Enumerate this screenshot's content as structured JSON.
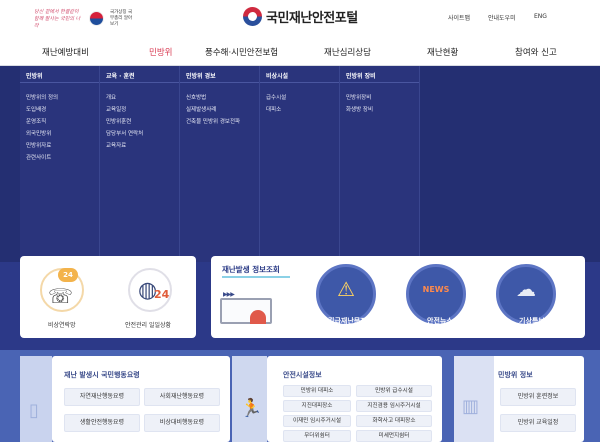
{
  "header": {
    "slogan_line1": "당신 곁에서 한결같이",
    "slogan_line2": "함께 잘사는 국민의 나라",
    "gov_mark": "국가상징 국무총리 알아보기",
    "logo": "국민재난안전포털",
    "util": {
      "sitemap": "사이트맵",
      "guide": "안내도우미",
      "eng": "ENG"
    }
  },
  "gnb": [
    {
      "label": "재난예방대비",
      "active": false
    },
    {
      "label": "민방위",
      "active": true
    },
    {
      "label": "풍수해·시민안전보험",
      "active": false
    },
    {
      "label": "재난심리상담",
      "active": false
    },
    {
      "label": "재난현황",
      "active": false
    },
    {
      "label": "참여와 신고",
      "active": false
    }
  ],
  "mega": [
    {
      "head": "민방위",
      "items": [
        "민방위의 정의",
        "도입배경",
        "운영조직",
        "외국민방위",
        "민방위자료",
        "관련사이트"
      ]
    },
    {
      "head": "교육 · 훈련",
      "items": [
        "개요",
        "교육일정",
        "민방위훈련",
        "담당부서 연락처",
        "교육자료"
      ]
    },
    {
      "head": "민방위 경보",
      "items": [
        "신호방법",
        "실제발생사례",
        "건축물 민방위 경보전파"
      ]
    },
    {
      "head": "비상시설",
      "items": [
        "급수시설",
        "대피소"
      ]
    },
    {
      "head": "민방위 장비",
      "items": [
        "민방위장비",
        "화생방 장비"
      ]
    }
  ],
  "services": {
    "emergency_label": "비상연락망",
    "safety_label": "안전관리 일일상황",
    "badge": "24"
  },
  "disaster_info": {
    "title": "재난발생 정보조회",
    "alert": "긴급재난문자",
    "news": "안전뉴스",
    "news_badge": "NEWS",
    "weather": "기상특보"
  },
  "panels": {
    "action": {
      "title": "재난 발생시 국민행동요령",
      "buttons": [
        "자연재난행동요령",
        "사회재난행동요령",
        "생활안전행동요령",
        "비상대비행동요령"
      ]
    },
    "facility": {
      "title": "안전시설정보",
      "buttons": [
        "민방위 대피소",
        "민방위 급수시설",
        "지진대피장소",
        "지진겸용 임시주거시설",
        "이재민 임시주거시설",
        "화학사고 대피장소",
        "무더위쉼터",
        "미세먼지쉼터"
      ]
    },
    "civil": {
      "title": "민방위 정보",
      "buttons": [
        "민방위 훈련정보",
        "민방위 교육일정"
      ]
    }
  }
}
